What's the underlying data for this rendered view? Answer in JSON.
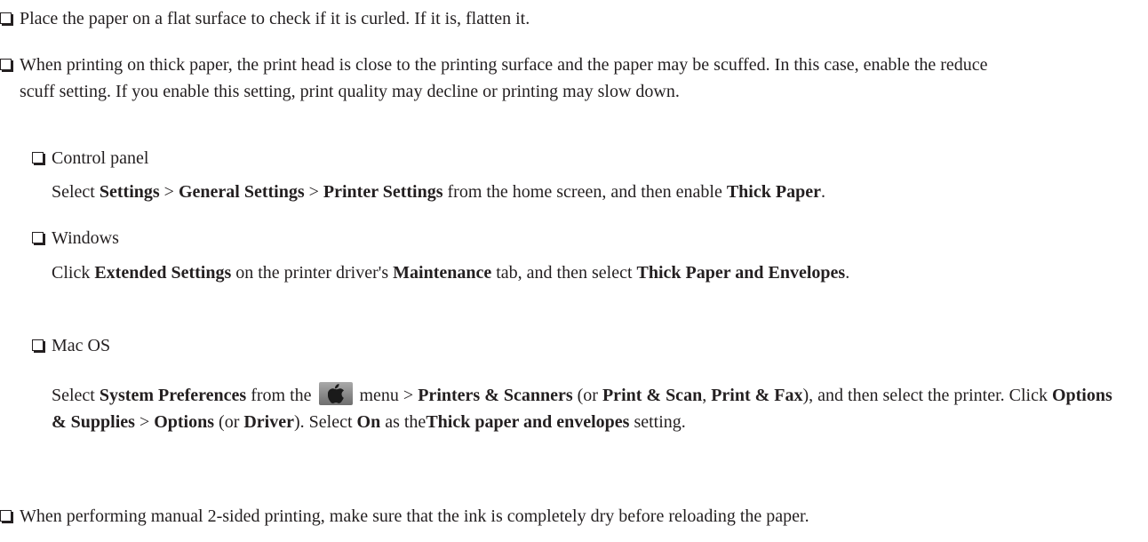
{
  "bullets": {
    "flat": "Place the paper on a flat surface to check if it is curled. If it is, flatten it.",
    "thick": "When printing on thick paper, the print head is close to the printing surface and the paper may be scuffed. In this case, enable the reduce scuff setting. If you enable this setting, print quality may decline or printing may slow down.",
    "manual": "When performing manual 2-sided printing, make sure that the ink is completely dry before reloading the paper."
  },
  "control_panel": {
    "title": "Control panel",
    "t1": "Select ",
    "b1": "Settings",
    "t2": " > ",
    "b2": "General Settings",
    "t3": " > ",
    "b3": "Printer Settings",
    "t4": " from the home screen, and then enable ",
    "b4": "Thick Paper",
    "t5": "."
  },
  "windows": {
    "title": "Windows",
    "t1": "Click ",
    "b1": "Extended Settings",
    "t2": " on the printer driver's ",
    "b2": "Maintenance",
    "t3": " tab, and then select ",
    "b3": "Thick Paper and Envelopes",
    "t4": "."
  },
  "macos": {
    "title": "Mac OS",
    "t1": "Select ",
    "b1": "System Preferences",
    "t2": " from the ",
    "t3": " menu > ",
    "b2": "Printers & Scanners",
    "t4": " (or ",
    "b3": "Print & Scan",
    "t5": ", ",
    "b4": "Print & Fax",
    "t6": "), and then select the printer. Click ",
    "b5": "Options & Supplies",
    "t7": " > ",
    "b6": "Options",
    "t8": " (or ",
    "b7": "Driver",
    "t9": "). Select ",
    "b8": "On",
    "t10": " as the",
    "b9": "Thick paper and envelopes",
    "t11": " setting.",
    "icon": "apple-menu-icon"
  }
}
